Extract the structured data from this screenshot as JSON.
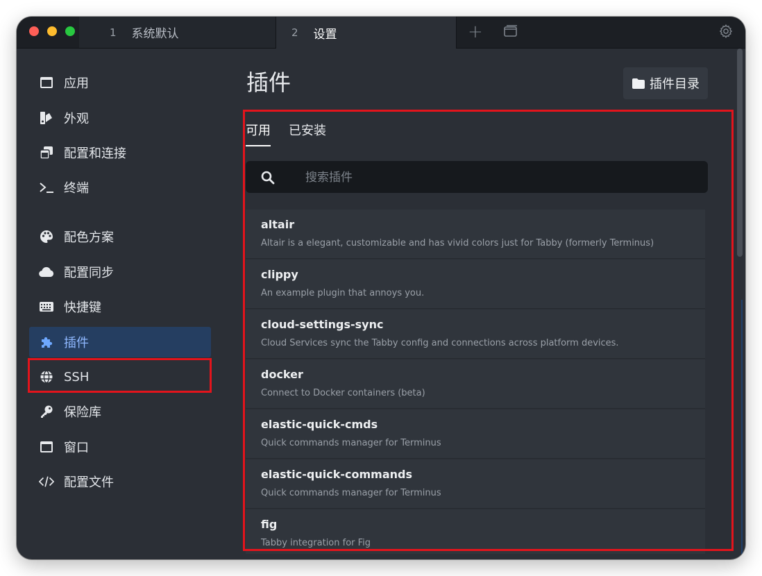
{
  "titlebar": {
    "tabs": [
      {
        "number": "1",
        "label": "系统默认"
      },
      {
        "number": "2",
        "label": "设置"
      }
    ],
    "new_tab_symbol": "+",
    "icons": [
      "close-dot",
      "minimize-dot",
      "maximize-dot",
      "plus-icon",
      "window-icon",
      "gear-icon"
    ]
  },
  "sidebar": {
    "items": [
      {
        "label": "应用",
        "icon": "app-window-icon"
      },
      {
        "label": "外观",
        "icon": "appearance-icon"
      },
      {
        "label": "配置和连接",
        "icon": "profiles-icon"
      },
      {
        "label": "终端",
        "icon": "terminal-icon"
      },
      {
        "label": "配色方案",
        "icon": "palette-icon"
      },
      {
        "label": "配置同步",
        "icon": "cloud-icon"
      },
      {
        "label": "快捷键",
        "icon": "keyboard-icon"
      },
      {
        "label": "插件",
        "icon": "puzzle-icon",
        "active": true
      },
      {
        "label": "SSH",
        "icon": "globe-icon"
      },
      {
        "label": "保险库",
        "icon": "key-icon"
      },
      {
        "label": "窗口",
        "icon": "window-icon"
      },
      {
        "label": "配置文件",
        "icon": "code-icon"
      }
    ]
  },
  "main": {
    "title": "插件",
    "plugin_dir_button": "插件目录",
    "tabs": [
      {
        "label": "可用",
        "active": true
      },
      {
        "label": "已安装",
        "active": false
      }
    ],
    "search": {
      "placeholder": "搜索插件",
      "value": ""
    },
    "plugins": [
      {
        "name": "altair",
        "description": "Altair is a elegant, customizable and has vivid colors just for Tabby (formerly Terminus)"
      },
      {
        "name": "clippy",
        "description": "An example plugin that annoys you."
      },
      {
        "name": "cloud-settings-sync",
        "description": "Cloud Services sync the Tabby config and connections across platform devices."
      },
      {
        "name": "docker",
        "description": "Connect to Docker containers (beta)"
      },
      {
        "name": "elastic-quick-cmds",
        "description": "Quick commands manager for Terminus"
      },
      {
        "name": "elastic-quick-commands",
        "description": "Quick commands manager for Terminus"
      },
      {
        "name": "fig",
        "description": "Tabby integration for Fig"
      }
    ]
  },
  "colors": {
    "highlight_border": "#e3141c",
    "active_nav_bg": "#253e61",
    "window_bg": "#2b2f36",
    "titlebar_bg": "#1c1f24"
  }
}
